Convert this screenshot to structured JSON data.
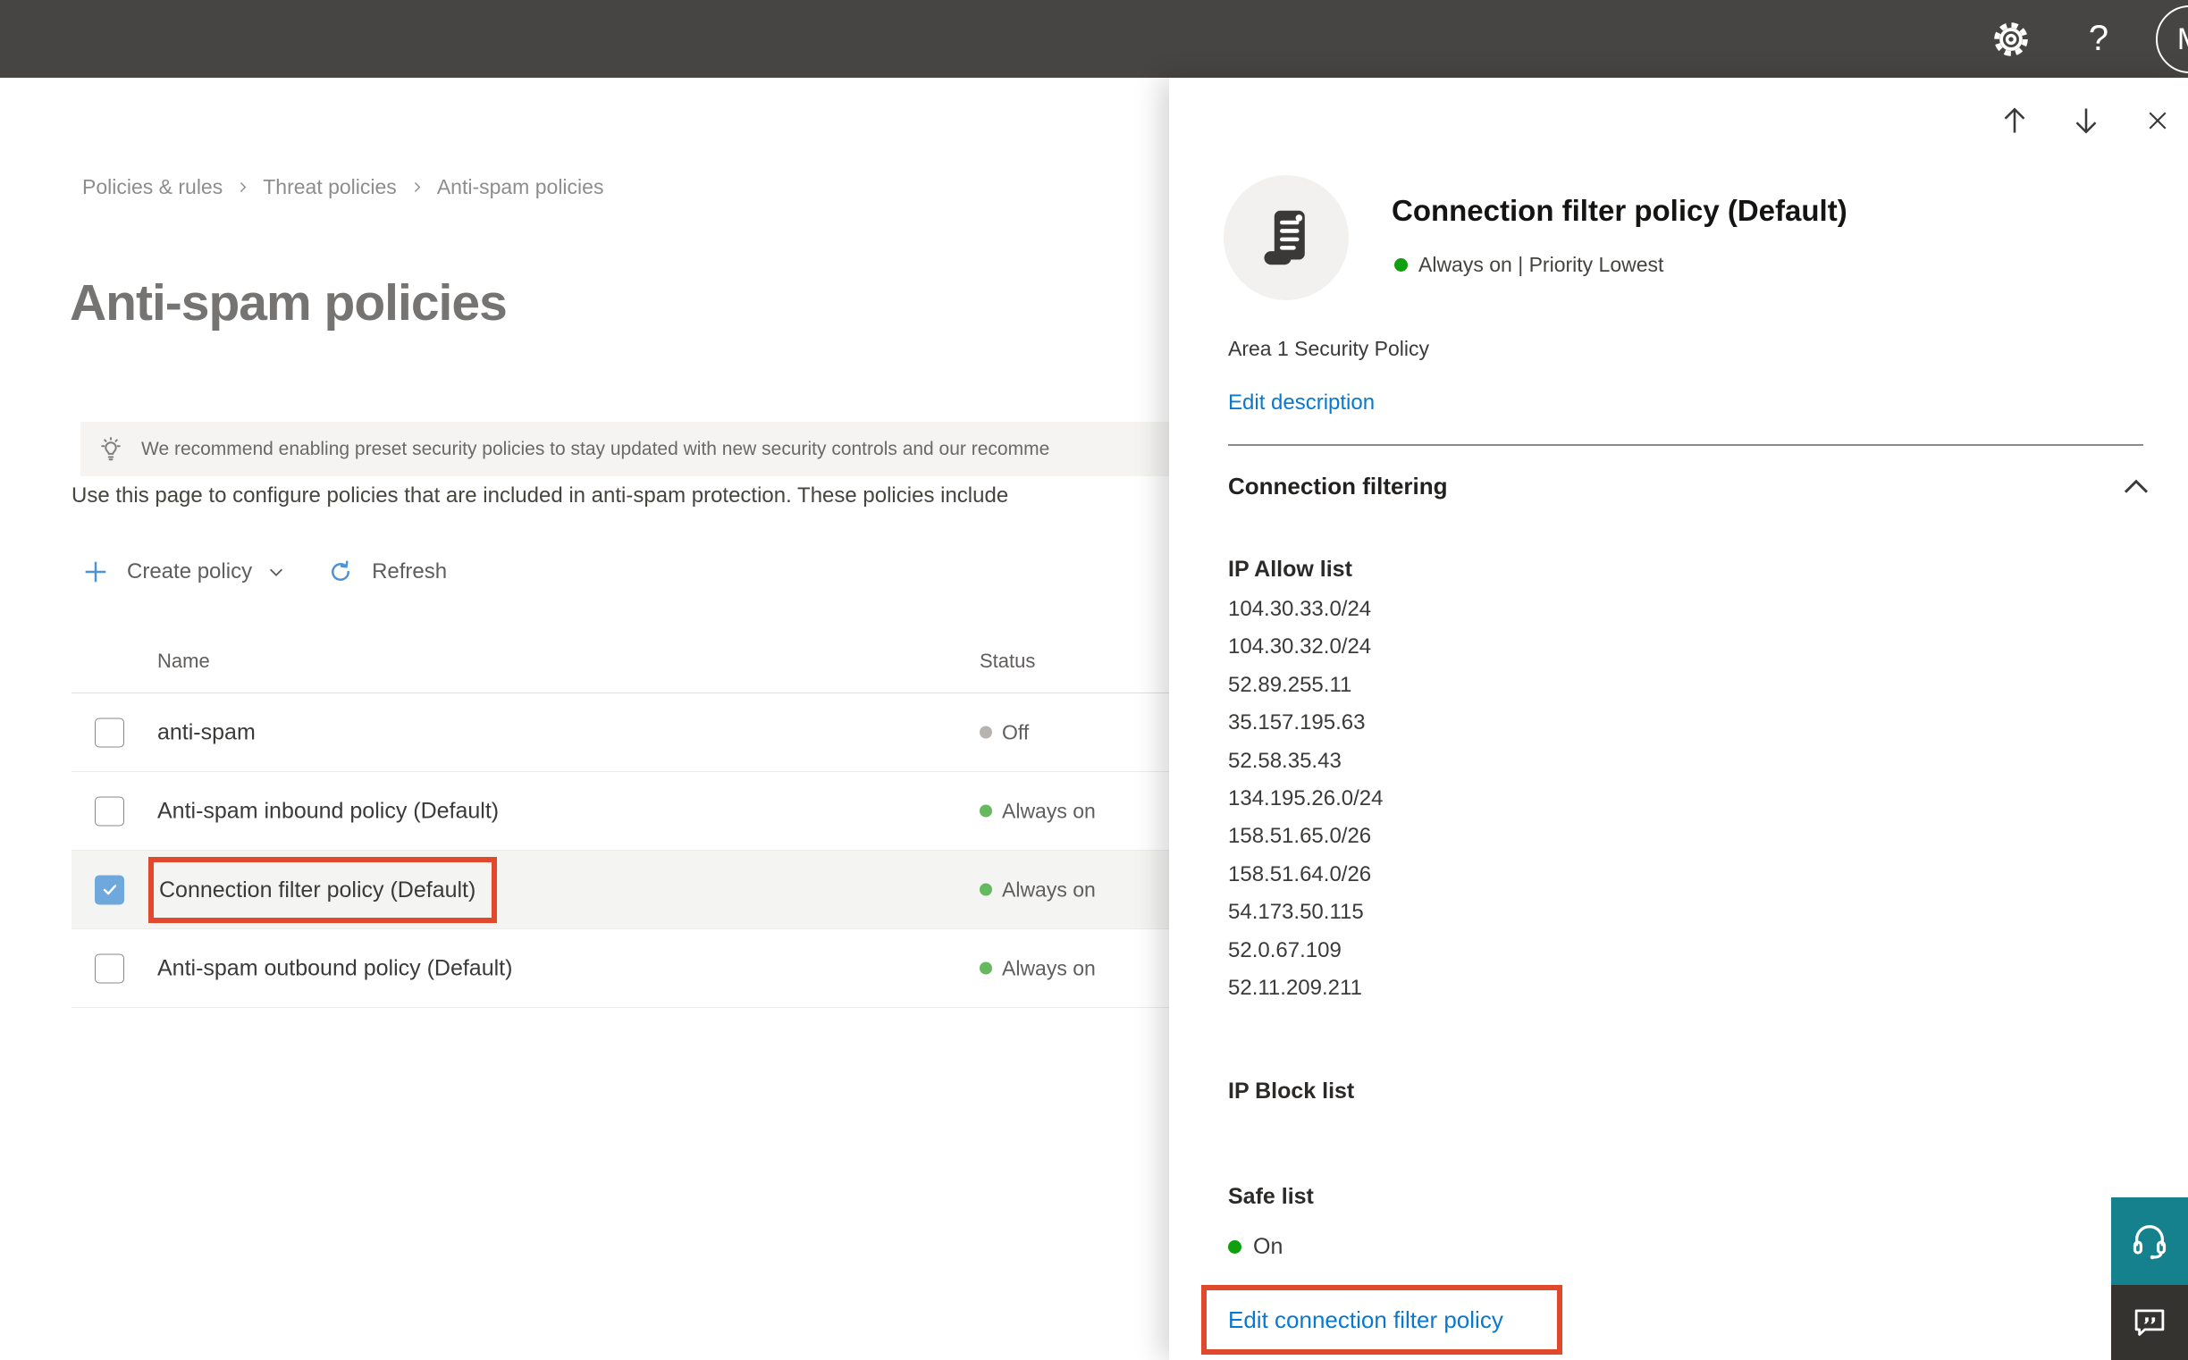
{
  "topbar": {
    "avatar_initial": "M",
    "help_label": "?"
  },
  "breadcrumb": [
    "Policies & rules",
    "Threat policies",
    "Anti-spam policies"
  ],
  "page": {
    "title": "Anti-spam policies",
    "banner_text": "We recommend enabling preset security policies to stay updated with new security controls and our recomme",
    "description": "Use this page to configure policies that are included in anti-spam protection. These policies include"
  },
  "toolbar": {
    "create_label": "Create policy",
    "refresh_label": "Refresh"
  },
  "table": {
    "columns": [
      "Name",
      "Status"
    ],
    "rows": [
      {
        "name": "anti-spam",
        "status": "Off",
        "status_color": "#b6b3b0",
        "checked": false,
        "selected": false,
        "annotated": false
      },
      {
        "name": "Anti-spam inbound policy (Default)",
        "status": "Always on",
        "status_color": "#66b95f",
        "checked": false,
        "selected": false,
        "annotated": false
      },
      {
        "name": "Connection filter policy (Default)",
        "status": "Always on",
        "status_color": "#66b95f",
        "checked": true,
        "selected": true,
        "annotated": true
      },
      {
        "name": "Anti-spam outbound policy (Default)",
        "status": "Always on",
        "status_color": "#66b95f",
        "checked": false,
        "selected": false,
        "annotated": false
      }
    ]
  },
  "panel": {
    "title": "Connection filter policy (Default)",
    "status_text": "Always on | Priority Lowest",
    "status_color": "#0f9f0f",
    "description": "Area 1 Security Policy",
    "edit_description_label": "Edit description",
    "section_title": "Connection filtering",
    "ip_allow": {
      "heading": "IP Allow list",
      "items": [
        "104.30.33.0/24",
        "104.30.32.0/24",
        "52.89.255.11",
        "35.157.195.63",
        "52.58.35.43",
        "134.195.26.0/24",
        "158.51.65.0/26",
        "158.51.64.0/26",
        "54.173.50.115",
        "52.0.67.109",
        "52.11.209.211"
      ]
    },
    "ip_block_heading": "IP Block list",
    "safe_list": {
      "heading": "Safe list",
      "value": "On",
      "status_color": "#0f9f0f"
    },
    "edit_link_label": "Edit connection filter policy"
  },
  "colors": {
    "annotation_red": "#e0492c",
    "link_blue": "#0878d0",
    "accent_blue": "#4d94d6",
    "checkbox_blue": "#6fa8dd"
  }
}
